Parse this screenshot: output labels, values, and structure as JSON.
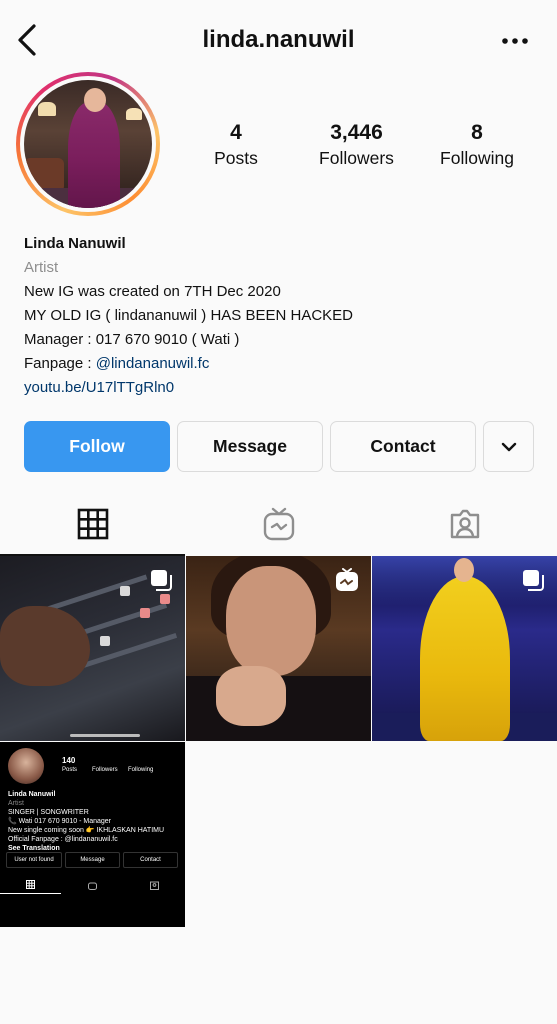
{
  "header": {
    "username": "linda.nanuwil",
    "back_icon": "chevron-left-icon",
    "more_icon": "more-horizontal-icon"
  },
  "profile": {
    "stats": [
      {
        "value": "4",
        "label": "Posts"
      },
      {
        "value": "3,446",
        "label": "Followers"
      },
      {
        "value": "8",
        "label": "Following"
      }
    ],
    "name": "Linda Nanuwil",
    "category": "Artist",
    "bio_lines": [
      "New IG was created on 7TH Dec 2020",
      "MY OLD IG ( lindananuwil ) HAS BEEN HACKED",
      "Manager : 017 670 9010 ( Wati )"
    ],
    "fanpage_prefix": "Fanpage : ",
    "fanpage_mention": "@lindananuwil.fc",
    "website": "youtu.be/U17lTTgRln0"
  },
  "actions": {
    "follow": "Follow",
    "message": "Message",
    "contact": "Contact",
    "more_icon": "chevron-down-icon"
  },
  "tabs": [
    {
      "name": "grid",
      "icon": "grid-icon",
      "active": true
    },
    {
      "name": "igtv",
      "icon": "igtv-icon",
      "active": false
    },
    {
      "name": "tagged",
      "icon": "tagged-person-icon",
      "active": false
    }
  ],
  "posts": [
    {
      "type": "carousel",
      "badge_icon": "multiple-posts-icon"
    },
    {
      "type": "igtv",
      "badge_icon": "igtv-icon"
    },
    {
      "type": "carousel",
      "badge_icon": "multiple-posts-icon"
    },
    {
      "type": "image",
      "mini_profile": {
        "posts_count": "140",
        "posts_label": "Posts",
        "followers_label": "Followers",
        "following_label": "Following",
        "name": "Linda Nanuwil",
        "category": "Artist",
        "lines": [
          "SINGER | SONGWRITER",
          "📞 Wati 017 670 9010 - Manager",
          "New single coming soon 👉 IKHLASKAN HATIMU",
          "Official Fanpage : @lindananuwil.fc",
          "See Translation"
        ],
        "buttons": [
          "User not found",
          "Message",
          "Contact"
        ]
      }
    }
  ],
  "colors": {
    "accent_blue": "#3897f0",
    "link": "#00376b",
    "muted": "#8e8e8e"
  }
}
